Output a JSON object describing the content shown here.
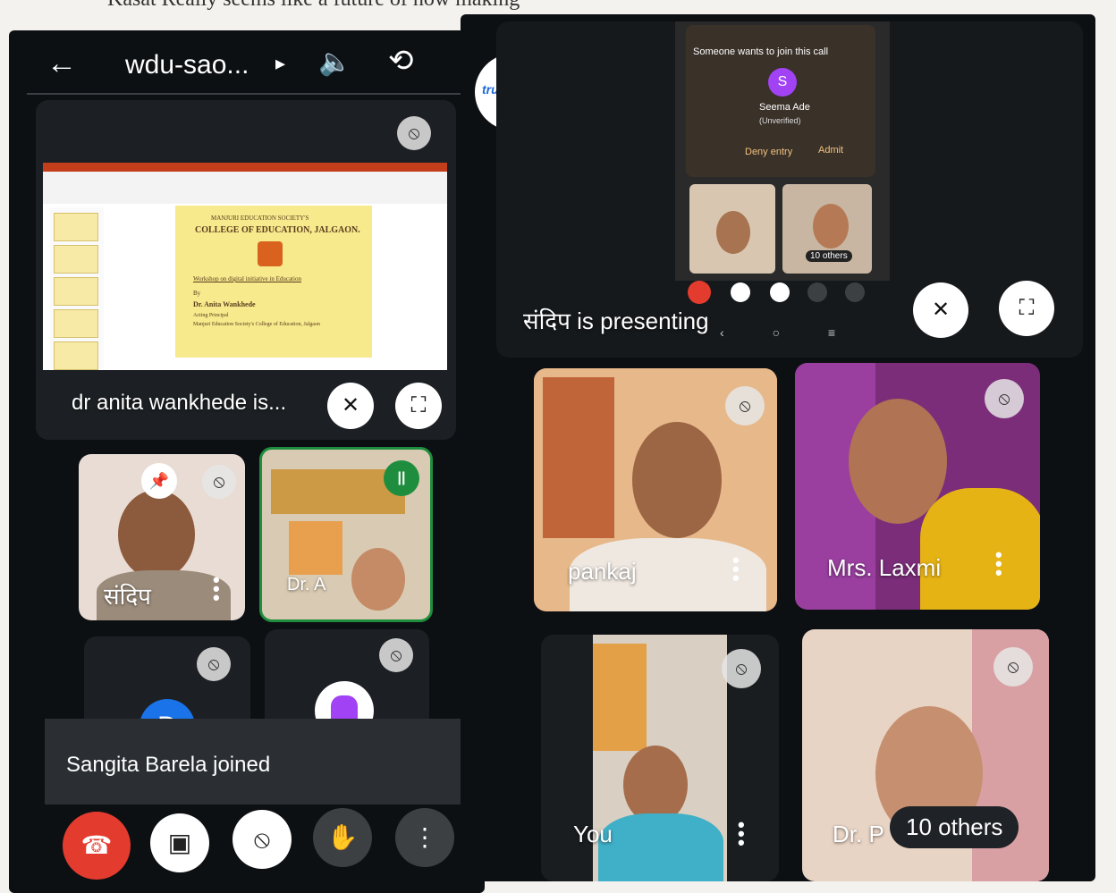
{
  "caption": "Kasat Really seems like a future of how making",
  "left": {
    "header": {
      "back_icon": "arrow-left-icon",
      "title": "wdu-sao...",
      "title_caret": "▸",
      "speaker_icon": "speaker-icon",
      "switch_camera_icon": "switch-camera-icon"
    },
    "presentation": {
      "label": "dr anita wankhede is...",
      "slide": {
        "society": "MANJURI EDUCATION SOCIETY'S",
        "college": "COLLEGE OF EDUCATION, JALGAON.",
        "workshop": "Workshop on digital initiative in Education",
        "by": "By",
        "presenter": "Dr. Anita Wankhede",
        "role": "Acting Principal",
        "affiliation": "Manjuri Education Society's College of Education, Jalgaon"
      }
    },
    "tiles": [
      {
        "name": "संदिप"
      },
      {
        "name": "Dr. A"
      },
      {
        "avatar_letter": "D"
      },
      {
        "name": ""
      }
    ],
    "toast": "Sangita Barela joined",
    "controls": [
      "end-call",
      "camera-off",
      "mic-off",
      "raise-hand",
      "more"
    ]
  },
  "right": {
    "truecaller_label": "truecaller",
    "join_request": {
      "title": "Someone wants to join this call",
      "avatar_letter": "S",
      "name": "Seema Ade",
      "status": "(Unverified)",
      "deny": "Deny entry",
      "admit": "Admit"
    },
    "mini_others": "10 others",
    "presenting": "संदिप is presenting",
    "tiles": [
      {
        "name": "pankaj"
      },
      {
        "name": "Mrs. Laxmi"
      },
      {
        "name": "You"
      },
      {
        "name": "Dr. P"
      }
    ],
    "others_badge": "10 others"
  },
  "colors": {
    "end_call": "#e33b2e",
    "meet_green": "#1e8e3e",
    "phone_bg": "#0d1013",
    "avatar_blue": "#1a73e8",
    "avatar_purple": "#a142f4"
  }
}
